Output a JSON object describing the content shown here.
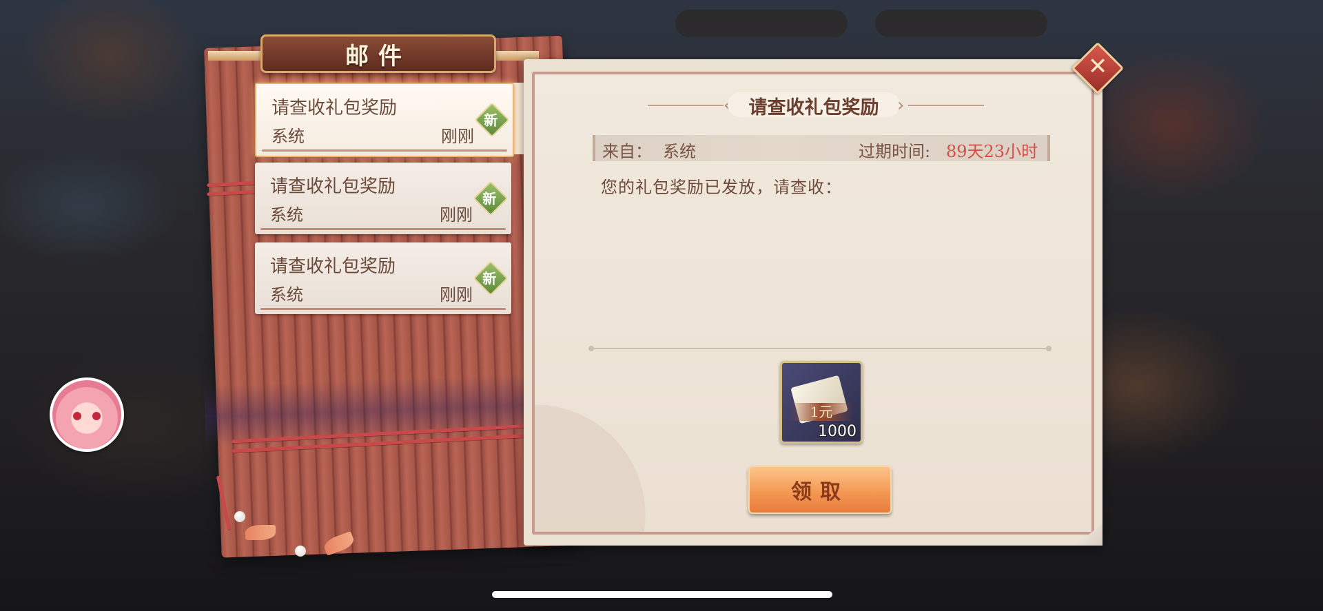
{
  "dialog": {
    "title": "邮件",
    "close_label": "✕"
  },
  "mail_list": [
    {
      "title": "请查收礼包奖励",
      "from": "系统",
      "time": "刚刚",
      "badge": "新",
      "selected": true
    },
    {
      "title": "请查收礼包奖励",
      "from": "系统",
      "time": "刚刚",
      "badge": "新",
      "selected": false
    },
    {
      "title": "请查收礼包奖励",
      "from": "系统",
      "time": "刚刚",
      "badge": "新",
      "selected": false
    }
  ],
  "letter": {
    "title": "请查收礼包奖励",
    "from_label": "来自：",
    "from_value": "系统",
    "expire_label": "过期时间:",
    "expire_value": "89天23小时",
    "body": "您的礼包奖励已发放，请查收：",
    "reward": {
      "name": "1元",
      "count": "1000",
      "icon": "voucher-scroll-icon"
    },
    "claim_label": "领取"
  },
  "colors": {
    "expire_text": "#d34e46",
    "claim_button": "#f49954",
    "new_badge": "#5e8a3a"
  }
}
